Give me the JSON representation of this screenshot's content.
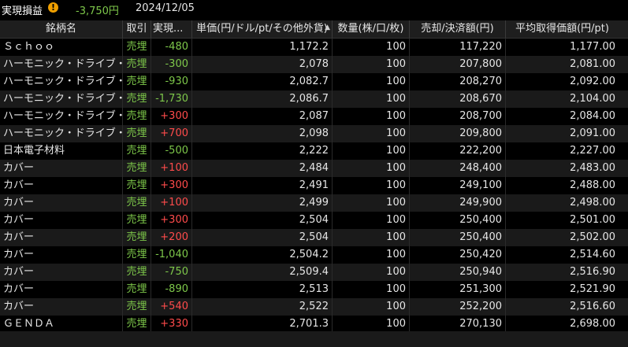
{
  "summary": {
    "label": "実現損益",
    "value": "-3,750円",
    "value_color": "#7ec84a",
    "date": "2024/12/05",
    "warning_icon": "!"
  },
  "columns": {
    "name": "銘柄名",
    "trade": "取引",
    "pl": "実現...",
    "unit_price": "単価(円/ドル/pt/その他外貨)",
    "qty": "数量(株/口/枚)",
    "settlement": "売却/決済額(円)",
    "avg_price": "平均取得価額(円/pt)"
  },
  "rows": [
    {
      "name": "Ｓｃｈｏｏ",
      "trade": "売埋",
      "pl": "-480",
      "unit": "1,172.2",
      "qty": "100",
      "settle": "117,220",
      "avg": "1,177.00"
    },
    {
      "name": "ハーモニック・ドライブ・シス",
      "trade": "売埋",
      "pl": "-300",
      "unit": "2,078",
      "qty": "100",
      "settle": "207,800",
      "avg": "2,081.00"
    },
    {
      "name": "ハーモニック・ドライブ・シス",
      "trade": "売埋",
      "pl": "-930",
      "unit": "2,082.7",
      "qty": "100",
      "settle": "208,270",
      "avg": "2,092.00"
    },
    {
      "name": "ハーモニック・ドライブ・シス",
      "trade": "売埋",
      "pl": "-1,730",
      "unit": "2,086.7",
      "qty": "100",
      "settle": "208,670",
      "avg": "2,104.00"
    },
    {
      "name": "ハーモニック・ドライブ・シス",
      "trade": "売埋",
      "pl": "+300",
      "unit": "2,087",
      "qty": "100",
      "settle": "208,700",
      "avg": "2,084.00"
    },
    {
      "name": "ハーモニック・ドライブ・シス",
      "trade": "売埋",
      "pl": "+700",
      "unit": "2,098",
      "qty": "100",
      "settle": "209,800",
      "avg": "2,091.00"
    },
    {
      "name": "日本電子材料",
      "trade": "売埋",
      "pl": "-500",
      "unit": "2,222",
      "qty": "100",
      "settle": "222,200",
      "avg": "2,227.00"
    },
    {
      "name": "カバー",
      "trade": "売埋",
      "pl": "+100",
      "unit": "2,484",
      "qty": "100",
      "settle": "248,400",
      "avg": "2,483.00"
    },
    {
      "name": "カバー",
      "trade": "売埋",
      "pl": "+300",
      "unit": "2,491",
      "qty": "100",
      "settle": "249,100",
      "avg": "2,488.00"
    },
    {
      "name": "カバー",
      "trade": "売埋",
      "pl": "+100",
      "unit": "2,499",
      "qty": "100",
      "settle": "249,900",
      "avg": "2,498.00"
    },
    {
      "name": "カバー",
      "trade": "売埋",
      "pl": "+300",
      "unit": "2,504",
      "qty": "100",
      "settle": "250,400",
      "avg": "2,501.00"
    },
    {
      "name": "カバー",
      "trade": "売埋",
      "pl": "+200",
      "unit": "2,504",
      "qty": "100",
      "settle": "250,400",
      "avg": "2,502.00"
    },
    {
      "name": "カバー",
      "trade": "売埋",
      "pl": "-1,040",
      "unit": "2,504.2",
      "qty": "100",
      "settle": "250,420",
      "avg": "2,514.60"
    },
    {
      "name": "カバー",
      "trade": "売埋",
      "pl": "-750",
      "unit": "2,509.4",
      "qty": "100",
      "settle": "250,940",
      "avg": "2,516.90"
    },
    {
      "name": "カバー",
      "trade": "売埋",
      "pl": "-890",
      "unit": "2,513",
      "qty": "100",
      "settle": "251,300",
      "avg": "2,521.90"
    },
    {
      "name": "カバー",
      "trade": "売埋",
      "pl": "+540",
      "unit": "2,522",
      "qty": "100",
      "settle": "252,200",
      "avg": "2,516.60"
    },
    {
      "name": "ＧＥＮＤＡ",
      "trade": "売埋",
      "pl": "+330",
      "unit": "2,701.3",
      "qty": "100",
      "settle": "270,130",
      "avg": "2,698.00"
    }
  ],
  "colors": {
    "profit": "#ff4b4b",
    "loss": "#7ec84a",
    "trade_type": "#7ec84a",
    "warning": "#f0a000"
  },
  "icons": {
    "warning": "warning-icon",
    "sort": "sort-up-icon"
  }
}
